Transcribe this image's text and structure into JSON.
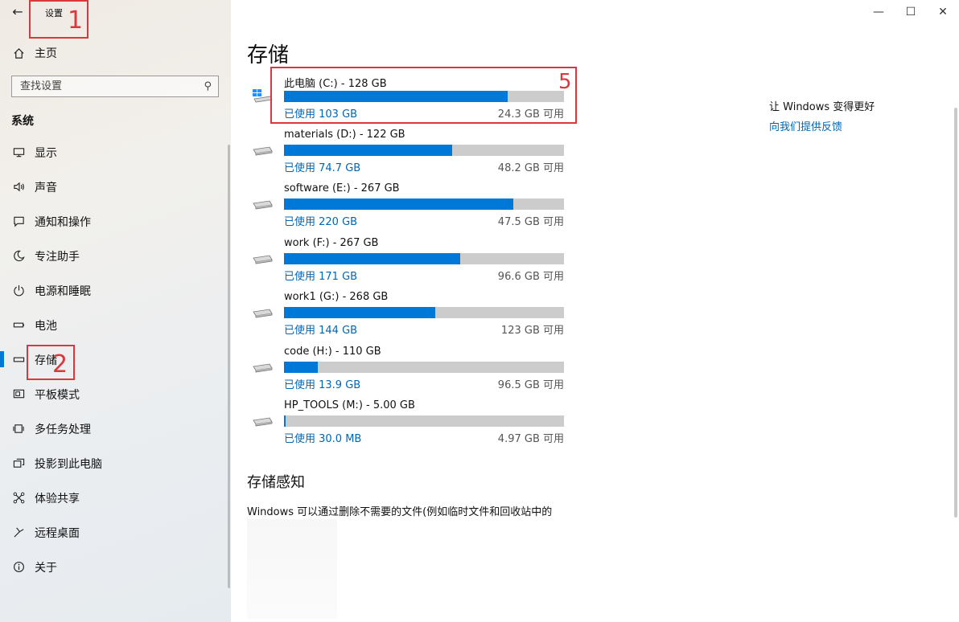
{
  "window": {
    "app_title": "设置",
    "back_icon": "back-arrow-icon",
    "controls": [
      "minimize-icon",
      "maximize-icon",
      "close-icon"
    ]
  },
  "annotations": [
    {
      "number": "1",
      "target": "app-title",
      "color": "#d9383f"
    },
    {
      "number": "2",
      "target": "sidebar-item-storage",
      "color": "#d9383f"
    },
    {
      "number": "5",
      "target": "drive-c",
      "color": "#d9383f"
    }
  ],
  "sidebar": {
    "home": {
      "label": "主页",
      "icon": "home-icon"
    },
    "search": {
      "placeholder": "查找设置",
      "icon": "search-icon"
    },
    "section_title": "系统",
    "items": [
      {
        "key": "display",
        "label": "显示",
        "icon": "monitor-icon"
      },
      {
        "key": "sound",
        "label": "声音",
        "icon": "speaker-icon"
      },
      {
        "key": "notifications",
        "label": "通知和操作",
        "icon": "notification-icon"
      },
      {
        "key": "focus",
        "label": "专注助手",
        "icon": "moon-icon"
      },
      {
        "key": "power",
        "label": "电源和睡眠",
        "icon": "power-icon"
      },
      {
        "key": "battery",
        "label": "电池",
        "icon": "battery-icon"
      },
      {
        "key": "storage",
        "label": "存储",
        "icon": "storage-icon",
        "selected": true
      },
      {
        "key": "tablet",
        "label": "平板模式",
        "icon": "tablet-icon"
      },
      {
        "key": "multitasking",
        "label": "多任务处理",
        "icon": "multitask-icon"
      },
      {
        "key": "projecting",
        "label": "投影到此电脑",
        "icon": "project-icon"
      },
      {
        "key": "shared",
        "label": "体验共享",
        "icon": "share-icon"
      },
      {
        "key": "remote",
        "label": "远程桌面",
        "icon": "remote-icon"
      },
      {
        "key": "about",
        "label": "关于",
        "icon": "info-icon"
      }
    ]
  },
  "main": {
    "title": "存储",
    "drives": [
      {
        "key": "c",
        "name": "此电脑 (C:) - 128 GB",
        "used": "已使用 103 GB",
        "free": "24.3 GB 可用",
        "used_fraction": 0.8,
        "icon": "system-drive-icon"
      },
      {
        "key": "d",
        "name": "materials (D:) - 122 GB",
        "used": "已使用 74.7 GB",
        "free": "48.2 GB 可用",
        "used_fraction": 0.6,
        "icon": "drive-icon"
      },
      {
        "key": "e",
        "name": "software (E:) - 267 GB",
        "used": "已使用 220 GB",
        "free": "47.5 GB 可用",
        "used_fraction": 0.82,
        "icon": "drive-icon"
      },
      {
        "key": "f",
        "name": "work (F:) - 267 GB",
        "used": "已使用 171 GB",
        "free": "96.6 GB 可用",
        "used_fraction": 0.63,
        "icon": "drive-icon"
      },
      {
        "key": "g",
        "name": "work1 (G:) - 268 GB",
        "used": "已使用 144 GB",
        "free": "123 GB 可用",
        "used_fraction": 0.54,
        "icon": "drive-icon"
      },
      {
        "key": "h",
        "name": "code (H:) - 110 GB",
        "used": "已使用 13.9 GB",
        "free": "96.5 GB 可用",
        "used_fraction": 0.12,
        "icon": "drive-icon"
      },
      {
        "key": "m",
        "name": "HP_TOOLS (M:) - 5.00 GB",
        "used": "已使用 30.0 MB",
        "free": "4.97 GB 可用",
        "used_fraction": 0.006,
        "icon": "drive-icon"
      }
    ],
    "storage_sense": {
      "title": "存储感知",
      "description": "Windows 可以通过删除不需要的文件(例如临时文件和回收站中的"
    },
    "feedback": {
      "heading": "让 Windows 变得更好",
      "link": "向我们提供反馈"
    }
  },
  "colors": {
    "accent": "#0078d7",
    "bar_bg": "#cccccc",
    "link": "#0066b4",
    "annotation": "#d9383f"
  }
}
